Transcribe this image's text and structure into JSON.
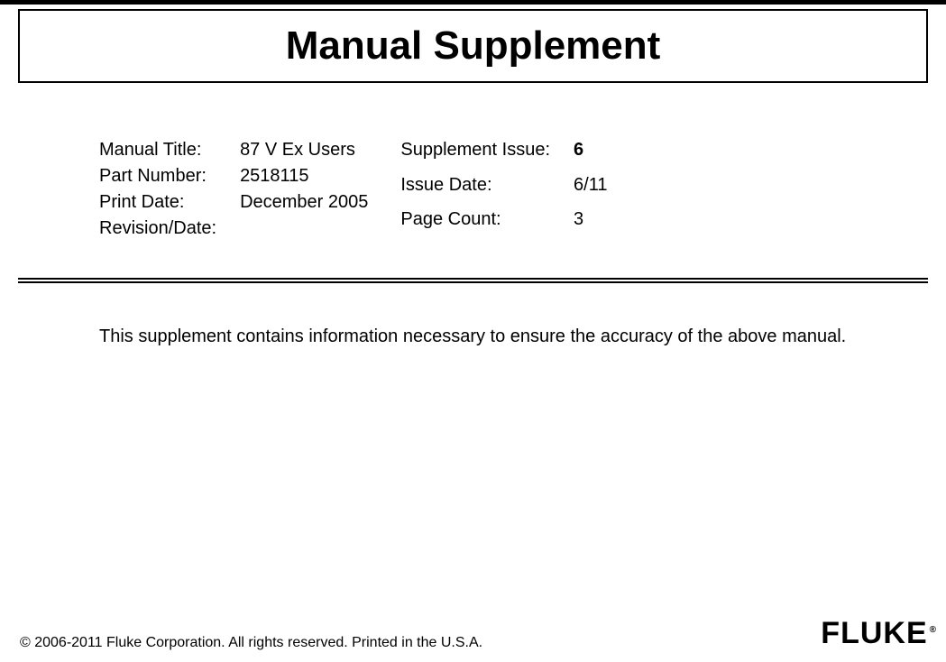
{
  "header": {
    "title": "Manual Supplement"
  },
  "info": {
    "left": [
      {
        "label": "Manual Title:",
        "value": "87 V Ex Users"
      },
      {
        "label": "Part Number:",
        "value": "2518115"
      },
      {
        "label": "Print Date:",
        "value": "December 2005"
      },
      {
        "label": "Revision/Date:",
        "value": ""
      }
    ],
    "right": [
      {
        "label": "Supplement Issue:",
        "value": "6",
        "bold": true
      },
      {
        "label": "Issue Date:",
        "value": "6/11"
      },
      {
        "label": "Page Count:",
        "value": "3"
      }
    ]
  },
  "body": {
    "text": "This supplement contains information necessary to ensure the accuracy of the above manual."
  },
  "footer": {
    "copyright": "© 2006-2011 Fluke Corporation. All rights reserved. Printed in the U.S.A.",
    "logo": "FLUKE",
    "logo_reg": "®"
  }
}
